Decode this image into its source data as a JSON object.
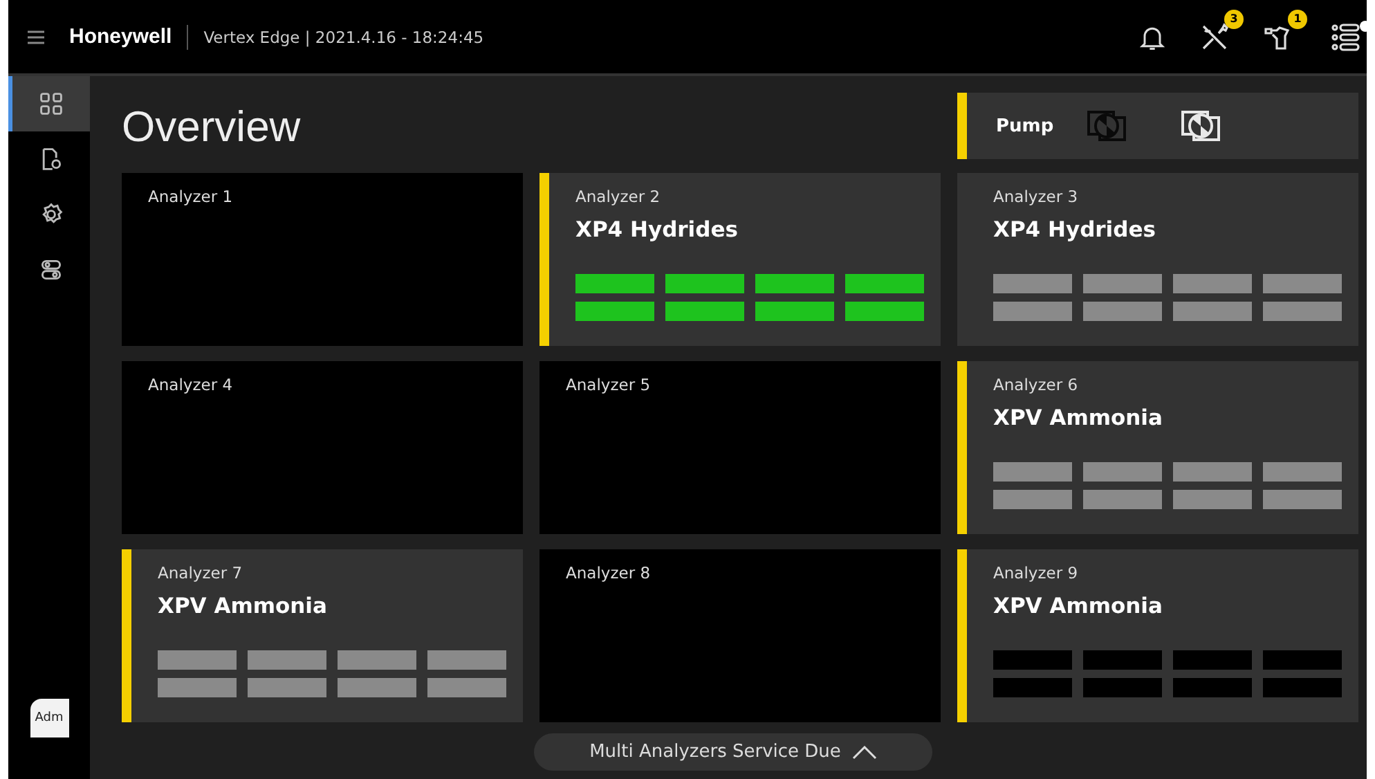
{
  "header": {
    "brand": "Honeywell",
    "title": "Vertex Edge | 2021.4.16 - 18:24:45",
    "icons": [
      {
        "kind": "bell"
      },
      {
        "kind": "tools",
        "badge": "3"
      },
      {
        "kind": "maintenance",
        "badge": "1"
      },
      {
        "kind": "list"
      }
    ]
  },
  "sidebar": {
    "items": [
      {
        "kind": "grid",
        "selected": true
      },
      {
        "kind": "document",
        "selected": false
      },
      {
        "kind": "gear",
        "selected": false
      },
      {
        "kind": "toggles",
        "selected": false
      }
    ],
    "user": "Adm"
  },
  "page_title": "Overview",
  "pump": {
    "label": "Pump",
    "pumps": [
      {
        "active": false
      },
      {
        "active": true
      }
    ]
  },
  "analyzers": [
    {
      "label": "Analyzer 1",
      "kind": "empty"
    },
    {
      "label": "Analyzer 2",
      "kind": "device",
      "alert": true,
      "name": "XP4 Hydrides",
      "color": "#1ec31e"
    },
    {
      "label": "Analyzer 3",
      "kind": "device",
      "alert": false,
      "name": "XP4 Hydrides",
      "color": "#8a8a8a"
    },
    {
      "label": "Analyzer 4",
      "kind": "empty"
    },
    {
      "label": "Analyzer 5",
      "kind": "empty"
    },
    {
      "label": "Analyzer 6",
      "kind": "device",
      "alert": true,
      "name": "XPV Ammonia",
      "color": "#8a8a8a"
    },
    {
      "label": "Analyzer 7",
      "kind": "device",
      "alert": true,
      "name": "XPV Ammonia",
      "color": "#8a8a8a"
    },
    {
      "label": "Analyzer 8",
      "kind": "empty"
    },
    {
      "label": "Analyzer 9",
      "kind": "device",
      "alert": true,
      "name": "XPV Ammonia",
      "color": "#000000"
    }
  ],
  "service_button": {
    "label": "Multi Analyzers Service Due"
  }
}
